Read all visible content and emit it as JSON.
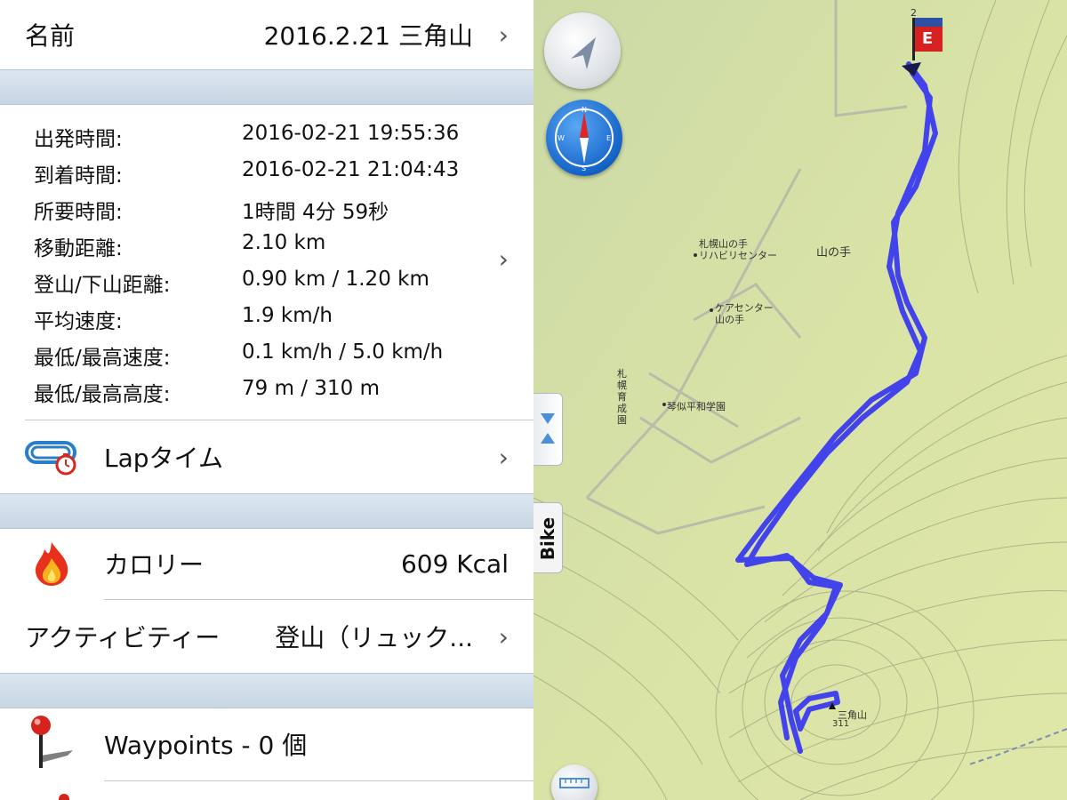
{
  "header": {
    "name_label": "名前",
    "name_value": "2016.2.21 三角山"
  },
  "stats": [
    {
      "label": "出発時間:",
      "value": "2016-02-21 19:55:36"
    },
    {
      "label": "到着時間:",
      "value": "2016-02-21 21:04:43"
    },
    {
      "label": "所要時間:",
      "value": "1時間 4分 59秒"
    },
    {
      "label": "移動距離:",
      "value": "2.10 km"
    },
    {
      "label": "登山/下山距離:",
      "value": "0.90 km / 1.20 km"
    },
    {
      "label": "平均速度:",
      "value": "1.9 km/h"
    },
    {
      "label": "最低/最高速度:",
      "value": "0.1 km/h / 5.0 km/h"
    },
    {
      "label": "最低/最高高度:",
      "value": "79 m / 310 m"
    }
  ],
  "lap": {
    "label": "Lapタイム"
  },
  "calorie": {
    "label": "カロリー",
    "value": "609 Kcal"
  },
  "activity": {
    "label": "アクティビティー",
    "value": "登山（リュック..."
  },
  "waypoints": {
    "label": "Waypoints - 0 個"
  },
  "map": {
    "labels": [
      "札幌山の手",
      "リハビリセンター",
      "山の手",
      "ケアセンター",
      "山の手",
      "札",
      "幌",
      "育",
      "成",
      "園",
      "琴似平和学園",
      "三角山",
      "311"
    ],
    "end_marker": "E",
    "marker_number": "2",
    "bike_tab": "Bike",
    "track_color": "#3b3bf0"
  }
}
